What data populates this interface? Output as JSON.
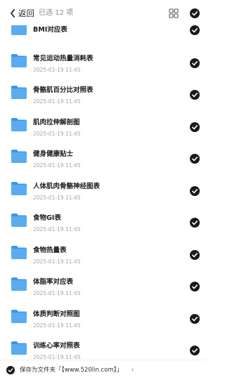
{
  "header": {
    "back_label": "返回",
    "count_label": "已选 12 项"
  },
  "items": [
    {
      "name": "BMI对应表",
      "date": ""
    },
    {
      "name": "常见运动热量消耗表",
      "date": "2025-01-19 11:45"
    },
    {
      "name": "骨骼肌百分比对照表",
      "date": "2025-01-19 11:45"
    },
    {
      "name": "肌肉拉伸解剖图",
      "date": "2025-01-19 11:45"
    },
    {
      "name": "健身健康贴士",
      "date": "2025-01-19 11:45"
    },
    {
      "name": "人体肌肉骨骼神经图表",
      "date": "2025-01-19 11:45"
    },
    {
      "name": "食物GI表",
      "date": "2025-01-19 11:45"
    },
    {
      "name": "食物热量表",
      "date": "2025-01-19 11:45"
    },
    {
      "name": "体脂率对应表",
      "date": "2025-01-19 11:45"
    },
    {
      "name": "体质判断对照图",
      "date": "2025-01-19 11:45"
    },
    {
      "name": "训练心率对照表",
      "date": "2025-01-19 11:45"
    }
  ],
  "footer": {
    "save_label": "保存为文件夹「【www.520lin.com】」",
    "chevron": "›"
  },
  "colors": {
    "folder": "#5aacf0",
    "folder_dark": "#3f95e3",
    "check_fill": "#1a1a1a",
    "accent_text": "#222222"
  },
  "icons": {
    "back": "chevron-left-icon",
    "grid": "grid-view-icon",
    "select_all": "checkmark-circle-icon",
    "item": "folder-icon",
    "item_check": "checkmark-circle-icon",
    "footer_check": "checkmark-circle-icon"
  }
}
